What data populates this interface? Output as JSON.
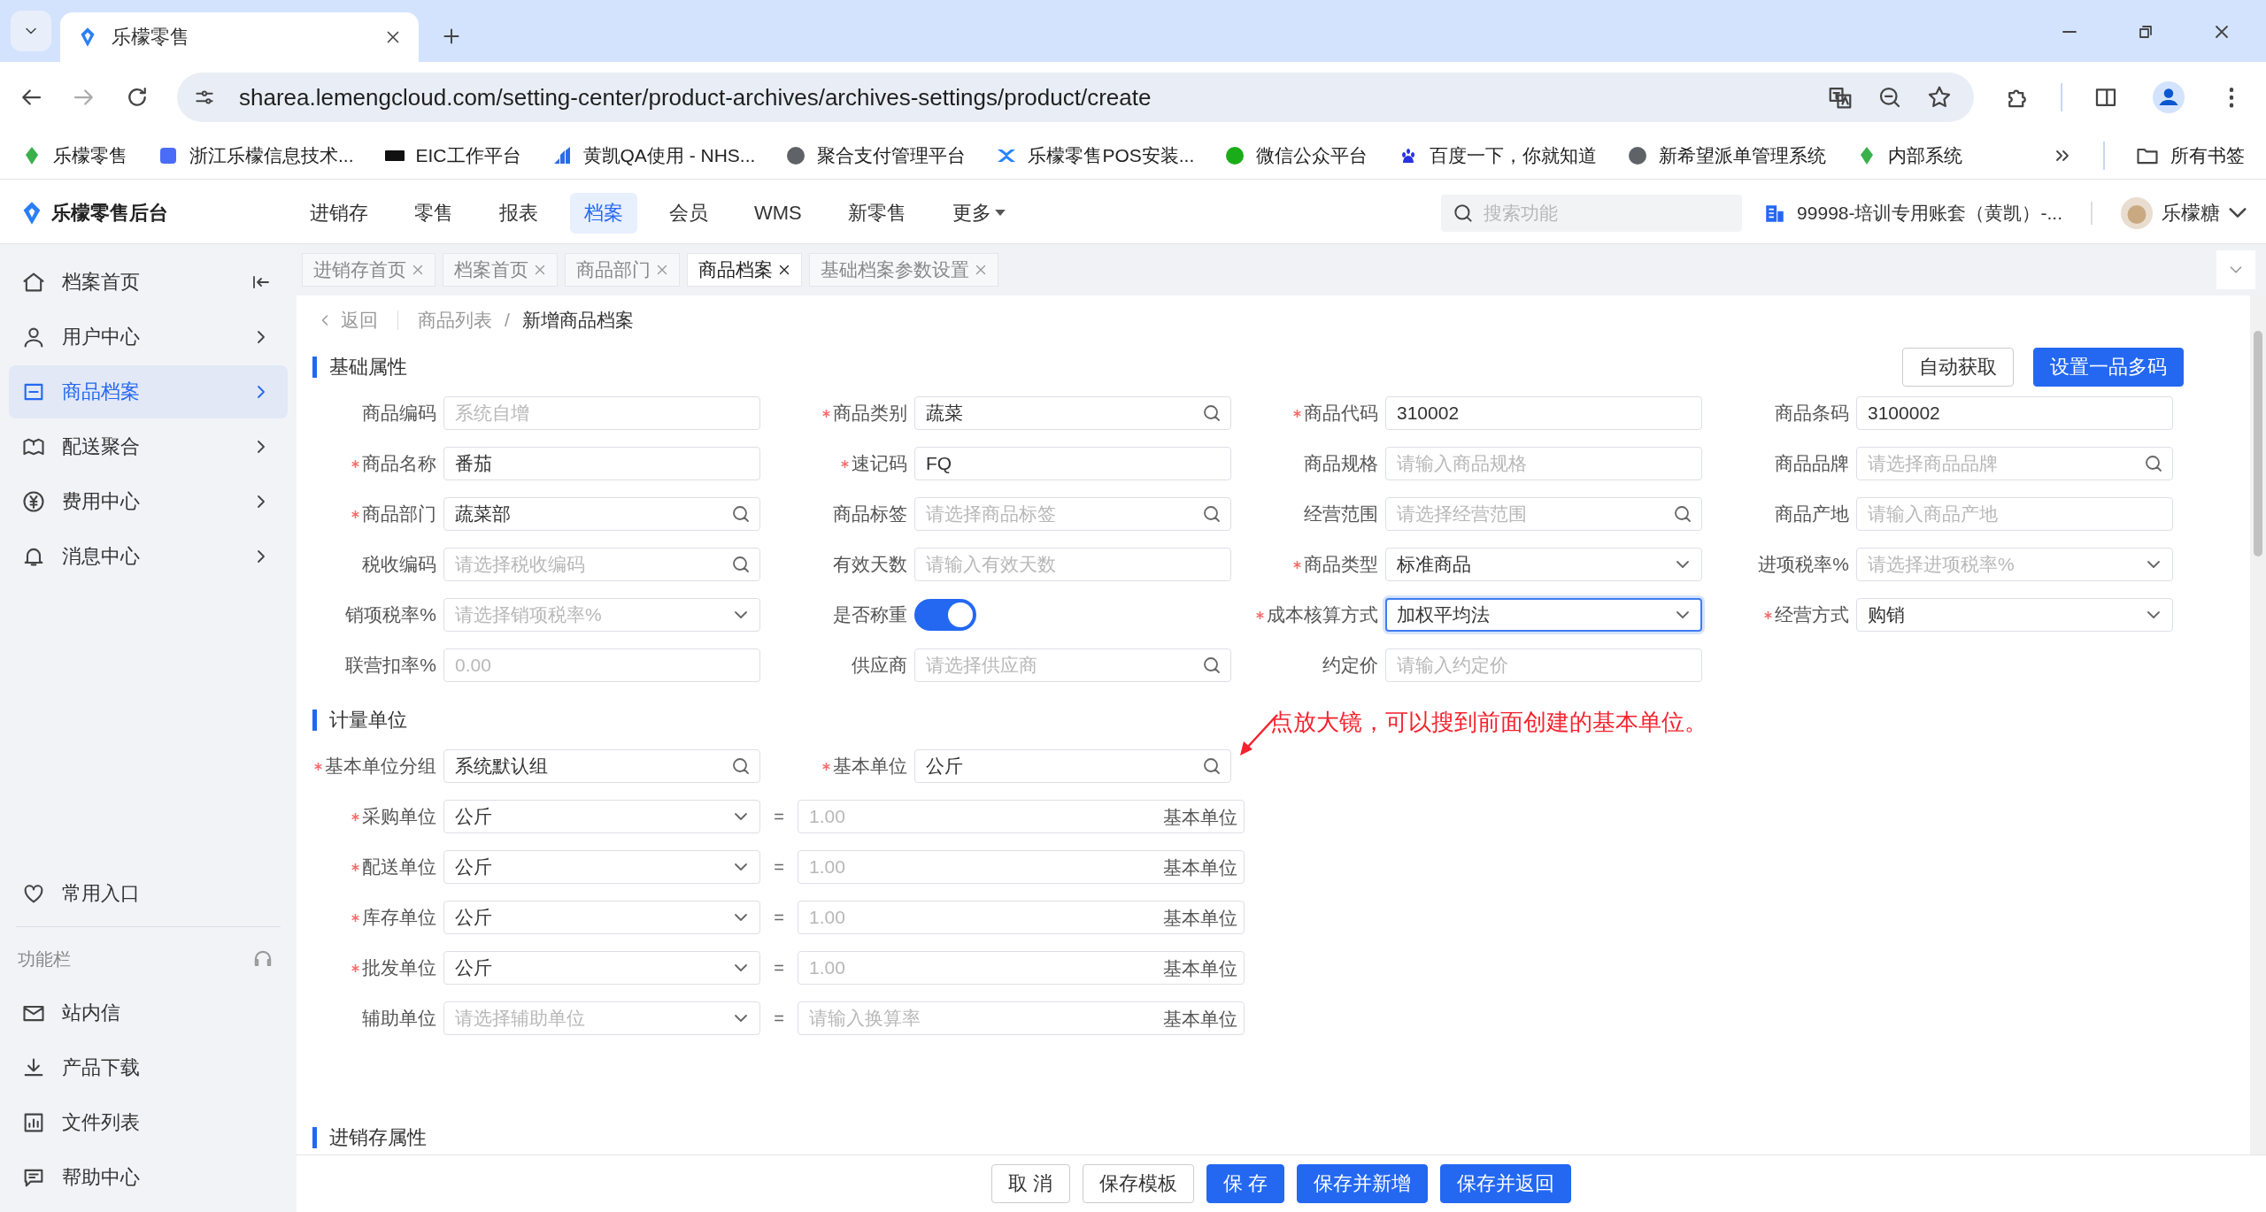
{
  "browser": {
    "tabs": [
      {
        "title": "乐檬零售",
        "selected": true
      }
    ],
    "url": "sharea.lemengcloud.com/setting-center/product-archives/archives-settings/product/create",
    "bookmarks": [
      "乐檬零售",
      "浙江乐檬信息技术...",
      "EIC工作平台",
      "黄凯QA使用 - NHS...",
      "聚合支付管理平台",
      "乐檬零售POS安装...",
      "微信公众平台",
      "百度一下，你就知道",
      "新希望派单管理系统",
      "内部系统"
    ],
    "all_bookmarks": "所有书签"
  },
  "app": {
    "name": "乐檬零售后台",
    "nav": [
      {
        "label": "进销存",
        "kind": "link",
        "selected": false
      },
      {
        "label": "零售",
        "kind": "link",
        "selected": false
      },
      {
        "label": "报表",
        "kind": "link",
        "selected": false
      },
      {
        "label": "档案",
        "kind": "link",
        "selected": true
      },
      {
        "label": "会员",
        "kind": "link",
        "selected": false
      },
      {
        "label": "WMS",
        "kind": "link",
        "selected": false
      },
      {
        "label": "新零售",
        "kind": "link",
        "selected": false
      },
      {
        "label": "更多",
        "kind": "dropdown",
        "selected": false
      }
    ],
    "search": {
      "placeholder": "搜索功能"
    },
    "account": "99998-培训专用账套（黄凯）-...",
    "user": "乐檬糖"
  },
  "sidebar": {
    "header": "档案首页",
    "items": [
      {
        "label": "用户中心",
        "selected": false
      },
      {
        "label": "商品档案",
        "selected": true
      },
      {
        "label": "配送聚合",
        "selected": false
      },
      {
        "label": "费用中心",
        "selected": false
      },
      {
        "label": "消息中心",
        "selected": false
      }
    ],
    "favorites": "常用入口",
    "toolbar_title": "功能栏",
    "tools": [
      "站内信",
      "产品下载",
      "文件列表",
      "帮助中心"
    ]
  },
  "page_tabs": [
    {
      "label": "进销存首页",
      "selected": false
    },
    {
      "label": "档案首页",
      "selected": false
    },
    {
      "label": "商品部门",
      "selected": false
    },
    {
      "label": "商品档案",
      "selected": true
    },
    {
      "label": "基础档案参数设置",
      "selected": false
    }
  ],
  "breadcrumb": {
    "back": "返回",
    "separator": "/",
    "path": [
      "商品列表",
      "新增商品档案"
    ]
  },
  "basic": {
    "title": "基础属性",
    "buttons": [
      {
        "label": "自动获取",
        "primary": false
      },
      {
        "label": "设置一品多码",
        "primary": true
      }
    ],
    "fields": [
      {
        "label": "商品编码",
        "required": false,
        "kind": "text",
        "placeholder": "系统自增"
      },
      {
        "label": "商品类别",
        "required": true,
        "kind": "search",
        "value": "蔬菜"
      },
      {
        "label": "商品代码",
        "required": true,
        "kind": "text",
        "value": "310002"
      },
      {
        "label": "商品条码",
        "required": false,
        "kind": "text",
        "value": "3100002"
      },
      {
        "label": "商品名称",
        "required": true,
        "kind": "text",
        "value": "番茄"
      },
      {
        "label": "速记码",
        "required": true,
        "kind": "text",
        "value": "FQ"
      },
      {
        "label": "商品规格",
        "required": false,
        "kind": "text",
        "placeholder": "请输入商品规格"
      },
      {
        "label": "商品品牌",
        "required": false,
        "kind": "search",
        "placeholder": "请选择商品品牌"
      },
      {
        "label": "商品部门",
        "required": true,
        "kind": "search",
        "value": "蔬菜部"
      },
      {
        "label": "商品标签",
        "required": false,
        "kind": "search",
        "placeholder": "请选择商品标签"
      },
      {
        "label": "经营范围",
        "required": false,
        "kind": "search",
        "placeholder": "请选择经营范围"
      },
      {
        "label": "商品产地",
        "required": false,
        "kind": "text",
        "placeholder": "请输入商品产地"
      },
      {
        "label": "税收编码",
        "required": false,
        "kind": "search",
        "placeholder": "请选择税收编码"
      },
      {
        "label": "有效天数",
        "required": false,
        "kind": "text",
        "placeholder": "请输入有效天数"
      },
      {
        "label": "商品类型",
        "required": true,
        "kind": "select",
        "value": "标准商品"
      },
      {
        "label": "进项税率%",
        "required": false,
        "kind": "select",
        "placeholder": "请选择进项税率%"
      },
      {
        "label": "销项税率%",
        "required": false,
        "kind": "select",
        "placeholder": "请选择销项税率%"
      },
      {
        "label": "是否称重",
        "required": false,
        "kind": "switch",
        "on": true
      },
      {
        "label": "成本核算方式",
        "required": true,
        "kind": "select",
        "value": "加权平均法",
        "focused": true
      },
      {
        "label": "经营方式",
        "required": true,
        "kind": "select",
        "value": "购销"
      },
      {
        "label": "联营扣率%",
        "required": false,
        "kind": "text",
        "placeholder": "0.00"
      },
      {
        "label": "供应商",
        "required": false,
        "kind": "search",
        "placeholder": "请选择供应商"
      },
      {
        "label": "约定价",
        "required": false,
        "kind": "text",
        "placeholder": "请输入约定价"
      }
    ]
  },
  "units": {
    "title": "计量单位",
    "base": [
      {
        "label": "基本单位分组",
        "required": true,
        "kind": "search",
        "value": "系统默认组"
      },
      {
        "label": "基本单位",
        "required": true,
        "kind": "search",
        "value": "公斤"
      }
    ],
    "annotation": "点放大镜，可以搜到前面创建的基本单位。",
    "conversions": [
      {
        "label": "采购单位",
        "required": true,
        "unit": {
          "value": "公斤"
        },
        "equals": "=",
        "ratio": {
          "placeholder": "1.00"
        },
        "base_unit": "基本单位"
      },
      {
        "label": "配送单位",
        "required": true,
        "unit": {
          "value": "公斤"
        },
        "equals": "=",
        "ratio": {
          "placeholder": "1.00"
        },
        "base_unit": "基本单位"
      },
      {
        "label": "库存单位",
        "required": true,
        "unit": {
          "value": "公斤"
        },
        "equals": "=",
        "ratio": {
          "placeholder": "1.00"
        },
        "base_unit": "基本单位"
      },
      {
        "label": "批发单位",
        "required": true,
        "unit": {
          "value": "公斤"
        },
        "equals": "=",
        "ratio": {
          "placeholder": "1.00"
        },
        "base_unit": "基本单位"
      },
      {
        "label": "辅助单位",
        "required": false,
        "unit": {
          "placeholder": "请选择辅助单位"
        },
        "equals": "=",
        "ratio": {
          "placeholder": "请输入换算率"
        },
        "base_unit": "基本单位"
      }
    ]
  },
  "next_section": {
    "title": "进销存属性"
  },
  "footer": {
    "buttons": [
      {
        "label": "取 消",
        "primary": false
      },
      {
        "label": "保存模板",
        "primary": false
      },
      {
        "label": "保 存",
        "primary": true
      },
      {
        "label": "保存并新增",
        "primary": true
      },
      {
        "label": "保存并返回",
        "primary": true
      }
    ]
  }
}
